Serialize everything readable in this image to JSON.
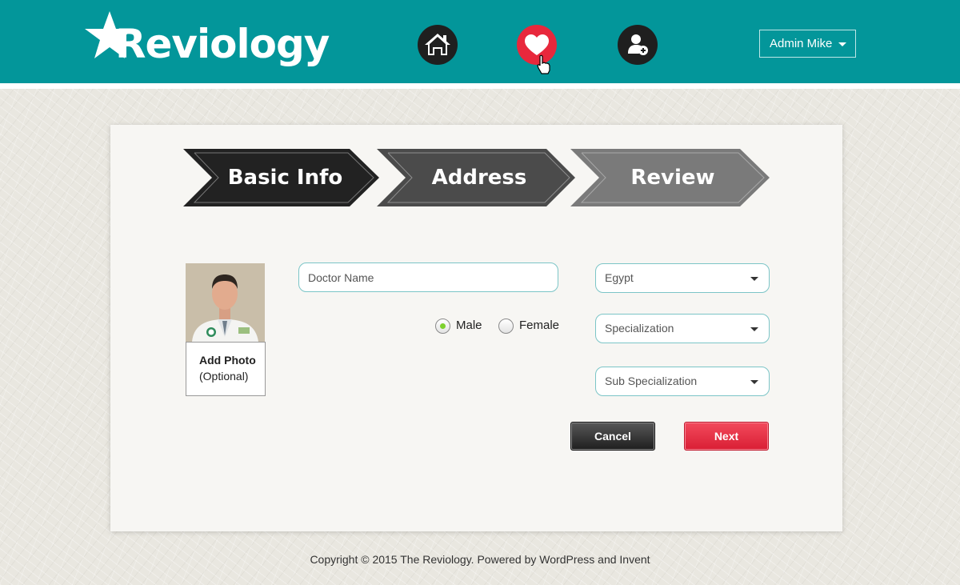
{
  "header": {
    "logo_text": "Reviology",
    "nav_icons": [
      "home-icon",
      "heart-icon",
      "add-user-icon"
    ],
    "user_menu_label": "Admin Mike"
  },
  "steps": [
    {
      "label": "Basic Info",
      "state": "active"
    },
    {
      "label": "Address",
      "state": "upcoming"
    },
    {
      "label": "Review",
      "state": "upcoming"
    }
  ],
  "photo": {
    "add_label": "Add Photo",
    "optional_label": "(Optional)"
  },
  "form": {
    "doctor_name_placeholder": "Doctor Name",
    "gender_options": [
      {
        "label": "Male",
        "selected": true
      },
      {
        "label": "Female",
        "selected": false
      }
    ],
    "country": "Egypt",
    "specialization": "Specialization",
    "sub_specialization": "Sub Specialization"
  },
  "buttons": {
    "cancel": "Cancel",
    "next": "Next"
  },
  "footer": {
    "text": "Copyright © 2015 The Reviology. Powered by WordPress and Invent"
  },
  "colors": {
    "header_bg": "#03969a",
    "accent_red": "#e8283c",
    "step_active": "#222222",
    "step_2": "#4b4b4b",
    "step_3": "#7a7a7a",
    "radio_selected": "#7dd12e"
  }
}
